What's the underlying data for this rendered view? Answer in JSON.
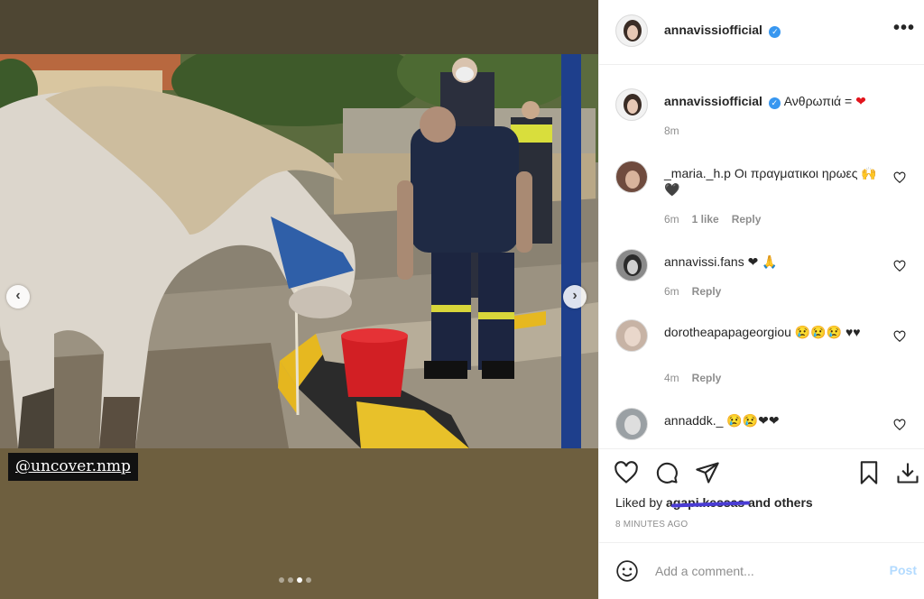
{
  "media": {
    "story_tag": "@uncover.nmp",
    "prev_arrow": "‹",
    "next_arrow": "›",
    "carousel_dots": 4,
    "carousel_active_index": 2
  },
  "header": {
    "username": "annavissiofficial",
    "verified": true,
    "more_label": "•••"
  },
  "caption": {
    "username": "annavissiofficial",
    "text": "Ανθρωπιά =",
    "emoji": "❤",
    "time": "8m"
  },
  "comments": [
    {
      "username": "_maria._h.p",
      "text": "Οι πραγματικοι ηρωες",
      "emoji": "🙌 🖤",
      "time": "6m",
      "likes": "1 like",
      "reply": "Reply"
    },
    {
      "username": "annavissi.fans",
      "text": "",
      "emoji": "❤ 🙏",
      "time": "6m",
      "likes": "",
      "reply": "Reply"
    },
    {
      "username": "dorotheapapageorgiou",
      "text": "",
      "emoji": "😢😢😢 ♥♥",
      "time": "4m",
      "likes": "",
      "reply": "Reply"
    },
    {
      "username": "annaddk._",
      "text": "",
      "emoji": "😢😢❤❤",
      "time": "",
      "likes": "",
      "reply": ""
    }
  ],
  "actions": {
    "liked_by_prefix": "Liked by ",
    "liked_by_user": "agapi.kessas",
    "liked_by_suffix": " and others",
    "time": "8 MINUTES AGO"
  },
  "add_comment": {
    "placeholder": "Add a comment...",
    "post_label": "Post"
  },
  "colors": {
    "accent": "#3897f0",
    "heart": "#e2141c",
    "post_disabled": "#b3dbff",
    "secondary_text": "#8e8e8e"
  }
}
